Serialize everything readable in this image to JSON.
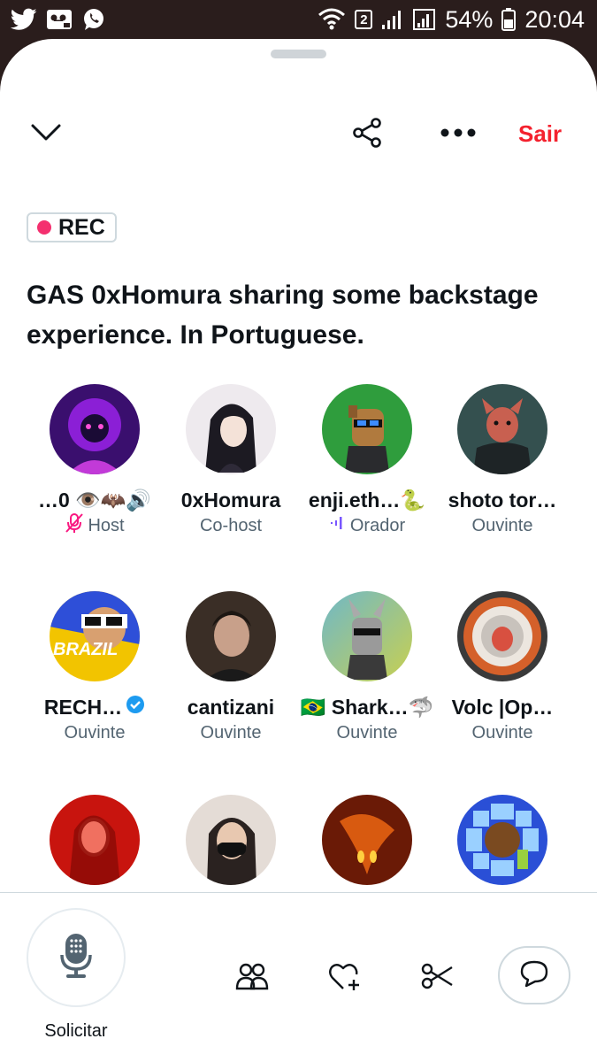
{
  "status_bar": {
    "battery": "54%",
    "time": "20:04",
    "wifi_badge": "2",
    "left_icons": [
      "twitter-icon",
      "voicemail-icon",
      "whatsapp-icon"
    ],
    "right_icons": [
      "wifi-icon",
      "signal-icon",
      "signal-icon",
      "battery-icon"
    ]
  },
  "header": {
    "collapse_icon": "chevron-down-icon",
    "share_icon": "share-icon",
    "more_icon": "more-icon",
    "exit_label": "Sair"
  },
  "space": {
    "rec_label": "REC",
    "title": "GAS 0xHomura sharing  some backstage experience. In Portuguese."
  },
  "participants": [
    {
      "name": "…0 👁️🦇🔊",
      "role": "Host",
      "role_icon": "mic-muted-icon",
      "avatar_color": "#6a1fa8"
    },
    {
      "name": "0xHomura",
      "role": "Co-host",
      "role_icon": "",
      "avatar_color": "#e9e6ea"
    },
    {
      "name": "enji.eth…🐍",
      "role": "Orador",
      "role_icon": "speaking-icon",
      "avatar_color": "#2f9d3d"
    },
    {
      "name": "shoto tor…",
      "role": "Ouvinte",
      "role_icon": "",
      "avatar_color": "#3c5d5a"
    },
    {
      "name": "RECH…",
      "role": "Ouvinte",
      "role_icon": "",
      "avatar_color": "#2e4fd8",
      "verified": true
    },
    {
      "name": "cantizani",
      "role": "Ouvinte",
      "role_icon": "",
      "avatar_color": "#4a3a30"
    },
    {
      "name": "🇧🇷 Shark…🦈",
      "role": "Ouvinte",
      "role_icon": "",
      "avatar_color": "#7fb06a"
    },
    {
      "name": "Volc |Op…",
      "role": "Ouvinte",
      "role_icon": "",
      "avatar_color": "#d4602a"
    },
    {
      "name": "",
      "role": "",
      "role_icon": "",
      "avatar_color": "#c8140e"
    },
    {
      "name": "",
      "role": "",
      "role_icon": "",
      "avatar_color": "#d9d2cc"
    },
    {
      "name": "",
      "role": "",
      "role_icon": "",
      "avatar_color": "#b8400c"
    },
    {
      "name": "",
      "role": "",
      "role_icon": "",
      "avatar_color": "#2a4fd6"
    }
  ],
  "footer": {
    "mic_label": "Solicitar",
    "people_icon": "people-icon",
    "react_icon": "heart-plus-icon",
    "clip_icon": "scissors-icon",
    "comment_icon": "comment-icon"
  },
  "colors": {
    "accent_red": "#f4212e",
    "rec_dot": "#f4306f",
    "verified": "#1d9bf0",
    "speaking": "#7856ff"
  }
}
